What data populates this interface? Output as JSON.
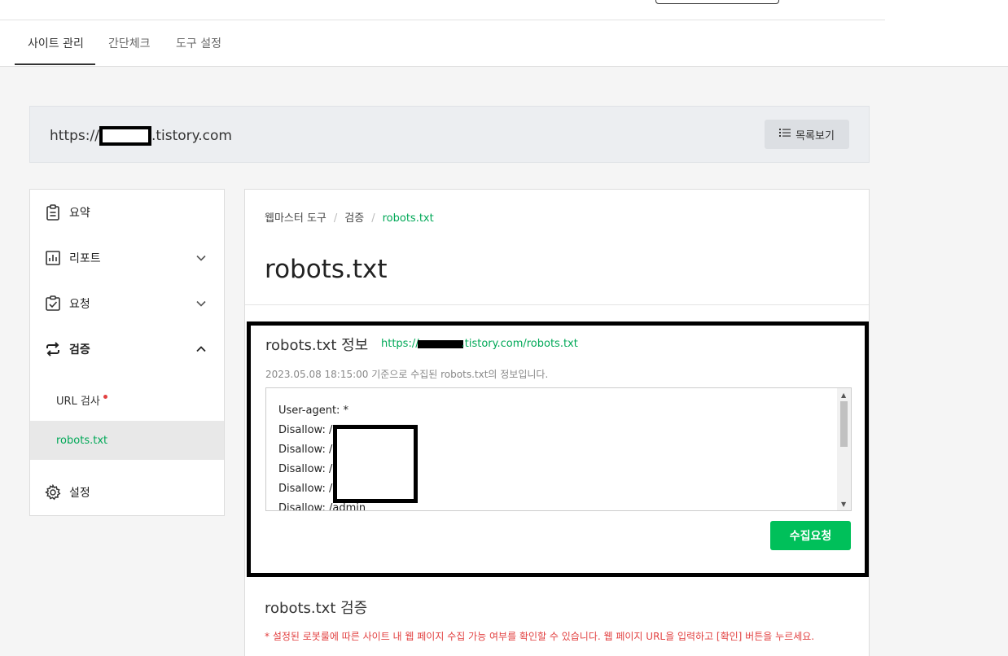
{
  "tabs": [
    {
      "label": "사이트 관리",
      "active": true
    },
    {
      "label": "간단체크",
      "active": false
    },
    {
      "label": "도구 설정",
      "active": false
    }
  ],
  "site": {
    "url_prefix": "https://",
    "url_suffix": ".tistory.com",
    "list_button": "목록보기"
  },
  "sidebar": {
    "items": [
      {
        "label": "요약",
        "icon": "clipboard-icon"
      },
      {
        "label": "리포트",
        "icon": "chart-icon"
      },
      {
        "label": "요청",
        "icon": "checkbox-icon"
      },
      {
        "label": "검증",
        "icon": "swap-icon"
      },
      {
        "label": "설정",
        "icon": "gear-icon"
      }
    ],
    "sub_items": [
      {
        "label": "URL 검사"
      },
      {
        "label": "robots.txt"
      }
    ]
  },
  "breadcrumb": [
    "웹마스터 도구",
    "검증",
    "robots.txt"
  ],
  "page_title": "robots.txt",
  "info": {
    "title": "robots.txt 정보",
    "url_prefix": "https://",
    "url_suffix": ".tistory.com/robots.txt",
    "description": "2023.05.08 18:15:00 기준으로 수집된 robots.txt의 정보입니다.",
    "lines": [
      "User-agent: *",
      "Disallow: /",
      "Disallow: /",
      "Disallow: /",
      "Disallow: /",
      "Disallow: /admin"
    ],
    "collect_button": "수집요청"
  },
  "verify": {
    "title": "robots.txt 검증",
    "description": "* 설정된 로봇룰에 따른 사이트 내 웹 페이지 수집 가능 여부를 확인할 수 있습니다. 웹 페이지 URL을 입력하고 [확인] 버튼을 누르세요."
  },
  "colors": {
    "accent_green": "#00a857",
    "button_green": "#00c05a",
    "alert_red": "#e24141"
  }
}
